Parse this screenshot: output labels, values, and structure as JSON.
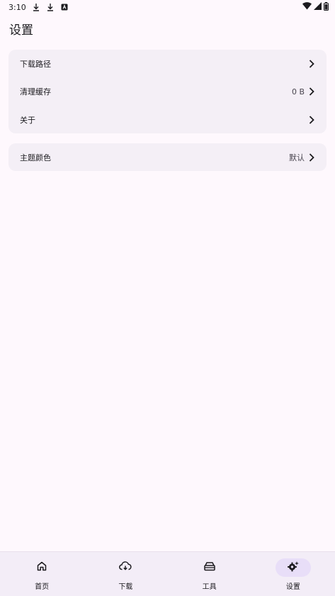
{
  "status_bar": {
    "time": "3:10"
  },
  "header": {
    "title": "设置"
  },
  "groups": [
    {
      "items": [
        {
          "label": "下载路径",
          "value": ""
        },
        {
          "label": "清理缓存",
          "value": "0 B"
        },
        {
          "label": "关于",
          "value": ""
        }
      ]
    },
    {
      "items": [
        {
          "label": "主题颜色",
          "value": "默认"
        }
      ]
    }
  ],
  "bottom_nav": {
    "active": "设置",
    "items": [
      {
        "label": "首页",
        "icon": "home-icon"
      },
      {
        "label": "下载",
        "icon": "cloud-download-icon"
      },
      {
        "label": "工具",
        "icon": "toolbox-icon"
      },
      {
        "label": "设置",
        "icon": "settings-icon"
      }
    ]
  },
  "colors": {
    "background": "#fef8fd",
    "card": "#f4eff6",
    "nav_bar": "#f3edf7",
    "active_indicator": "#e8def8"
  }
}
